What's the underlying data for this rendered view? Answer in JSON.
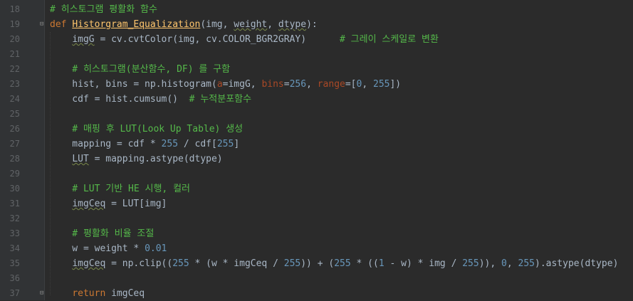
{
  "lines": [
    {
      "n": "18",
      "tokens": [
        {
          "t": "# 히스토그램 평활화 함수",
          "c": "cm"
        }
      ]
    },
    {
      "n": "19",
      "fold": "open",
      "tokens": [
        {
          "t": "def ",
          "c": "kw"
        },
        {
          "t": "Historgram_Equalization",
          "c": "fn"
        },
        {
          "t": "(img, ",
          "c": "plain"
        },
        {
          "t": "weight",
          "c": "plain squig"
        },
        {
          "t": ", ",
          "c": "plain"
        },
        {
          "t": "dtype",
          "c": "plain squig"
        },
        {
          "t": "):",
          "c": "plain"
        }
      ]
    },
    {
      "n": "20",
      "tokens": [
        {
          "t": "    ",
          "c": "plain"
        },
        {
          "t": "imgG",
          "c": "plain squig"
        },
        {
          "t": " = cv.cvtColor(img, cv.COLOR_BGR2GRAY)      ",
          "c": "plain"
        },
        {
          "t": "# 그레이 스케일로 변환",
          "c": "cm"
        }
      ]
    },
    {
      "n": "21",
      "tokens": []
    },
    {
      "n": "22",
      "tokens": [
        {
          "t": "    # 히스토그램(분산함수, DF) 를 구함",
          "c": "cm"
        }
      ]
    },
    {
      "n": "23",
      "tokens": [
        {
          "t": "    hist, bins = np.histogram(",
          "c": "plain"
        },
        {
          "t": "a",
          "c": "param"
        },
        {
          "t": "=imgG, ",
          "c": "plain"
        },
        {
          "t": "bins",
          "c": "param"
        },
        {
          "t": "=",
          "c": "plain"
        },
        {
          "t": "256",
          "c": "num"
        },
        {
          "t": ", ",
          "c": "plain"
        },
        {
          "t": "range",
          "c": "param"
        },
        {
          "t": "=[",
          "c": "plain"
        },
        {
          "t": "0",
          "c": "num"
        },
        {
          "t": ", ",
          "c": "plain"
        },
        {
          "t": "255",
          "c": "num"
        },
        {
          "t": "])",
          "c": "plain"
        }
      ]
    },
    {
      "n": "24",
      "tokens": [
        {
          "t": "    cdf = hist.cumsum()  ",
          "c": "plain"
        },
        {
          "t": "# 누적분포함수",
          "c": "cm"
        }
      ]
    },
    {
      "n": "25",
      "tokens": []
    },
    {
      "n": "26",
      "tokens": [
        {
          "t": "    # 매핑 후 LUT(Look Up Table) 생성",
          "c": "cm"
        }
      ]
    },
    {
      "n": "27",
      "tokens": [
        {
          "t": "    mapping = cdf * ",
          "c": "plain"
        },
        {
          "t": "255",
          "c": "num"
        },
        {
          "t": " / cdf[",
          "c": "plain"
        },
        {
          "t": "255",
          "c": "num"
        },
        {
          "t": "]",
          "c": "plain"
        }
      ]
    },
    {
      "n": "28",
      "tokens": [
        {
          "t": "    ",
          "c": "plain"
        },
        {
          "t": "LUT",
          "c": "plain squig"
        },
        {
          "t": " = mapping.astype(dtype)",
          "c": "plain"
        }
      ]
    },
    {
      "n": "29",
      "tokens": []
    },
    {
      "n": "30",
      "tokens": [
        {
          "t": "    # LUT 기반 HE 시행, 컬러",
          "c": "cm"
        }
      ]
    },
    {
      "n": "31",
      "tokens": [
        {
          "t": "    ",
          "c": "plain"
        },
        {
          "t": "imgCeq",
          "c": "plain squig"
        },
        {
          "t": " = LUT[img]",
          "c": "plain"
        }
      ]
    },
    {
      "n": "32",
      "tokens": []
    },
    {
      "n": "33",
      "tokens": [
        {
          "t": "    # 평활화 비율 조절",
          "c": "cm"
        }
      ]
    },
    {
      "n": "34",
      "tokens": [
        {
          "t": "    w = weight * ",
          "c": "plain"
        },
        {
          "t": "0.01",
          "c": "num"
        }
      ]
    },
    {
      "n": "35",
      "tokens": [
        {
          "t": "    ",
          "c": "plain"
        },
        {
          "t": "imgCeq",
          "c": "plain squig"
        },
        {
          "t": " = np.clip((",
          "c": "plain"
        },
        {
          "t": "255",
          "c": "num"
        },
        {
          "t": " * (w * imgCeq / ",
          "c": "plain"
        },
        {
          "t": "255",
          "c": "num"
        },
        {
          "t": ")) + (",
          "c": "plain"
        },
        {
          "t": "255",
          "c": "num"
        },
        {
          "t": " * ((",
          "c": "plain"
        },
        {
          "t": "1",
          "c": "num"
        },
        {
          "t": " - w) * img / ",
          "c": "plain"
        },
        {
          "t": "255",
          "c": "num"
        },
        {
          "t": ")), ",
          "c": "plain"
        },
        {
          "t": "0",
          "c": "num"
        },
        {
          "t": ", ",
          "c": "plain"
        },
        {
          "t": "255",
          "c": "num"
        },
        {
          "t": ").astype(dtype)",
          "c": "plain"
        }
      ]
    },
    {
      "n": "36",
      "tokens": []
    },
    {
      "n": "37",
      "fold": "close",
      "tokens": [
        {
          "t": "    ",
          "c": "plain"
        },
        {
          "t": "return",
          "c": "kw"
        },
        {
          "t": " imgCeq",
          "c": "plain"
        }
      ]
    }
  ]
}
